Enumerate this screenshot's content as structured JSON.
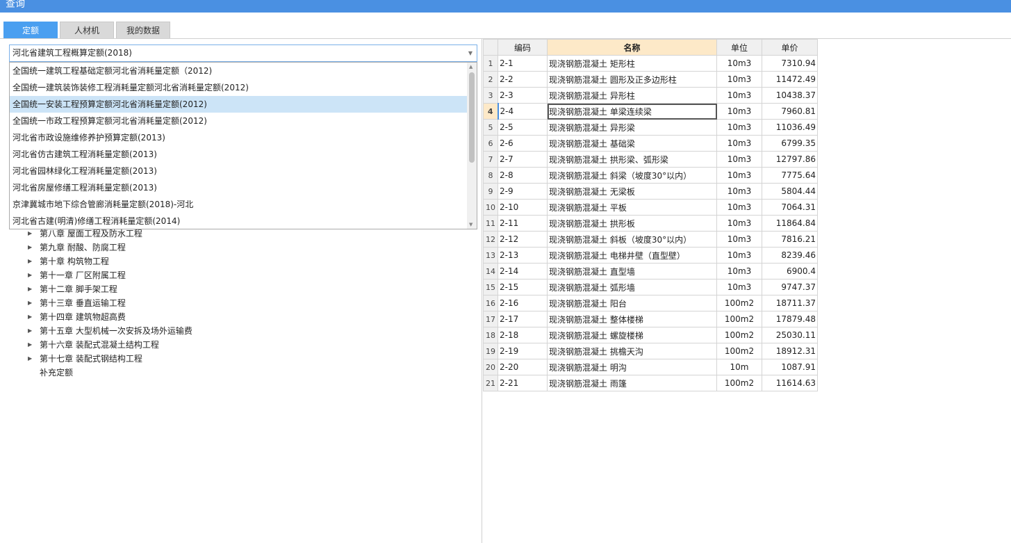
{
  "window": {
    "title": "查询"
  },
  "tabs": [
    {
      "label": "定额",
      "active": true
    },
    {
      "label": "人材机",
      "active": false
    },
    {
      "label": "我的数据",
      "active": false
    }
  ],
  "select": {
    "value": "河北省建筑工程概算定额(2018)",
    "options": [
      "全国统一建筑工程基础定额河北省消耗量定额（2012)",
      "全国统一建筑装饰装修工程消耗量定额河北省消耗量定额(2012)",
      "全国统一安装工程预算定额河北省消耗量定额(2012)",
      "全国统一市政工程预算定额河北省消耗量定额(2012)",
      "河北省市政设施维修养护预算定额(2013)",
      "河北省仿古建筑工程消耗量定额(2013)",
      "河北省园林绿化工程消耗量定额(2013)",
      "河北省房屋修缮工程消耗量定额(2013)",
      "京津冀城市地下综合管廊消耗量定额(2018)-河北",
      "河北省古建(明清)修缮工程消耗量定额(2014)"
    ],
    "highlighted_index": 2
  },
  "tree": [
    {
      "label": "第八章 屋面工程及防水工程",
      "expandable": true
    },
    {
      "label": "第九章 耐酸、防腐工程",
      "expandable": true
    },
    {
      "label": "第十章 构筑物工程",
      "expandable": true
    },
    {
      "label": "第十一章 厂区附属工程",
      "expandable": true
    },
    {
      "label": "第十二章 脚手架工程",
      "expandable": true
    },
    {
      "label": "第十三章 垂直运输工程",
      "expandable": true
    },
    {
      "label": "第十四章 建筑物超高费",
      "expandable": true
    },
    {
      "label": "第十五章 大型机械一次安拆及场外运输费",
      "expandable": true
    },
    {
      "label": "第十六章 装配式混凝土结构工程",
      "expandable": true
    },
    {
      "label": "第十七章 装配式钢结构工程",
      "expandable": true
    },
    {
      "label": "补充定额",
      "expandable": false
    }
  ],
  "grid": {
    "headers": [
      "",
      "编码",
      "名称",
      "单位",
      "单价"
    ],
    "current_row": 4,
    "rows": [
      [
        "1",
        "2-1",
        "现浇钢筋混凝土 矩形柱",
        "10m3",
        "7310.94"
      ],
      [
        "2",
        "2-2",
        "现浇钢筋混凝土 圆形及正多边形柱",
        "10m3",
        "11472.49"
      ],
      [
        "3",
        "2-3",
        "现浇钢筋混凝土 异形柱",
        "10m3",
        "10438.37"
      ],
      [
        "4",
        "2-4",
        "现浇钢筋混凝土 单梁连续梁",
        "10m3",
        "7960.81"
      ],
      [
        "5",
        "2-5",
        "现浇钢筋混凝土 异形梁",
        "10m3",
        "11036.49"
      ],
      [
        "6",
        "2-6",
        "现浇钢筋混凝土 基础梁",
        "10m3",
        "6799.35"
      ],
      [
        "7",
        "2-7",
        "现浇钢筋混凝土 拱形梁、弧形梁",
        "10m3",
        "12797.86"
      ],
      [
        "8",
        "2-8",
        "现浇钢筋混凝土 斜梁（坡度30°以内）",
        "10m3",
        "7775.64"
      ],
      [
        "9",
        "2-9",
        "现浇钢筋混凝土 无梁板",
        "10m3",
        "5804.44"
      ],
      [
        "10",
        "2-10",
        "现浇钢筋混凝土 平板",
        "10m3",
        "7064.31"
      ],
      [
        "11",
        "2-11",
        "现浇钢筋混凝土 拱形板",
        "10m3",
        "11864.84"
      ],
      [
        "12",
        "2-12",
        "现浇钢筋混凝土 斜板（坡度30°以内）",
        "10m3",
        "7816.21"
      ],
      [
        "13",
        "2-13",
        "现浇钢筋混凝土 电梯井壁（直型壁）",
        "10m3",
        "8239.46"
      ],
      [
        "14",
        "2-14",
        "现浇钢筋混凝土 直型墙",
        "10m3",
        "6900.4"
      ],
      [
        "15",
        "2-15",
        "现浇钢筋混凝土 弧形墙",
        "10m3",
        "9747.37"
      ],
      [
        "16",
        "2-16",
        "现浇钢筋混凝土 阳台",
        "100m2",
        "18711.37"
      ],
      [
        "17",
        "2-17",
        "现浇钢筋混凝土 整体楼梯",
        "100m2",
        "17879.48"
      ],
      [
        "18",
        "2-18",
        "现浇钢筋混凝土 螺旋楼梯",
        "100m2",
        "25030.11"
      ],
      [
        "19",
        "2-19",
        "现浇钢筋混凝土 挑檐天沟",
        "100m2",
        "18912.31"
      ],
      [
        "20",
        "2-20",
        "现浇钢筋混凝土 明沟",
        "10m",
        "1087.91"
      ],
      [
        "21",
        "2-21",
        "现浇钢筋混凝土 雨篷",
        "100m2",
        "11614.63"
      ]
    ]
  },
  "colors": {
    "title_bar": "#4a90e2",
    "active_tab": "#4a9ff0",
    "header_highlight": "#fde9c8",
    "dropdown_highlight": "#cce4f7"
  }
}
